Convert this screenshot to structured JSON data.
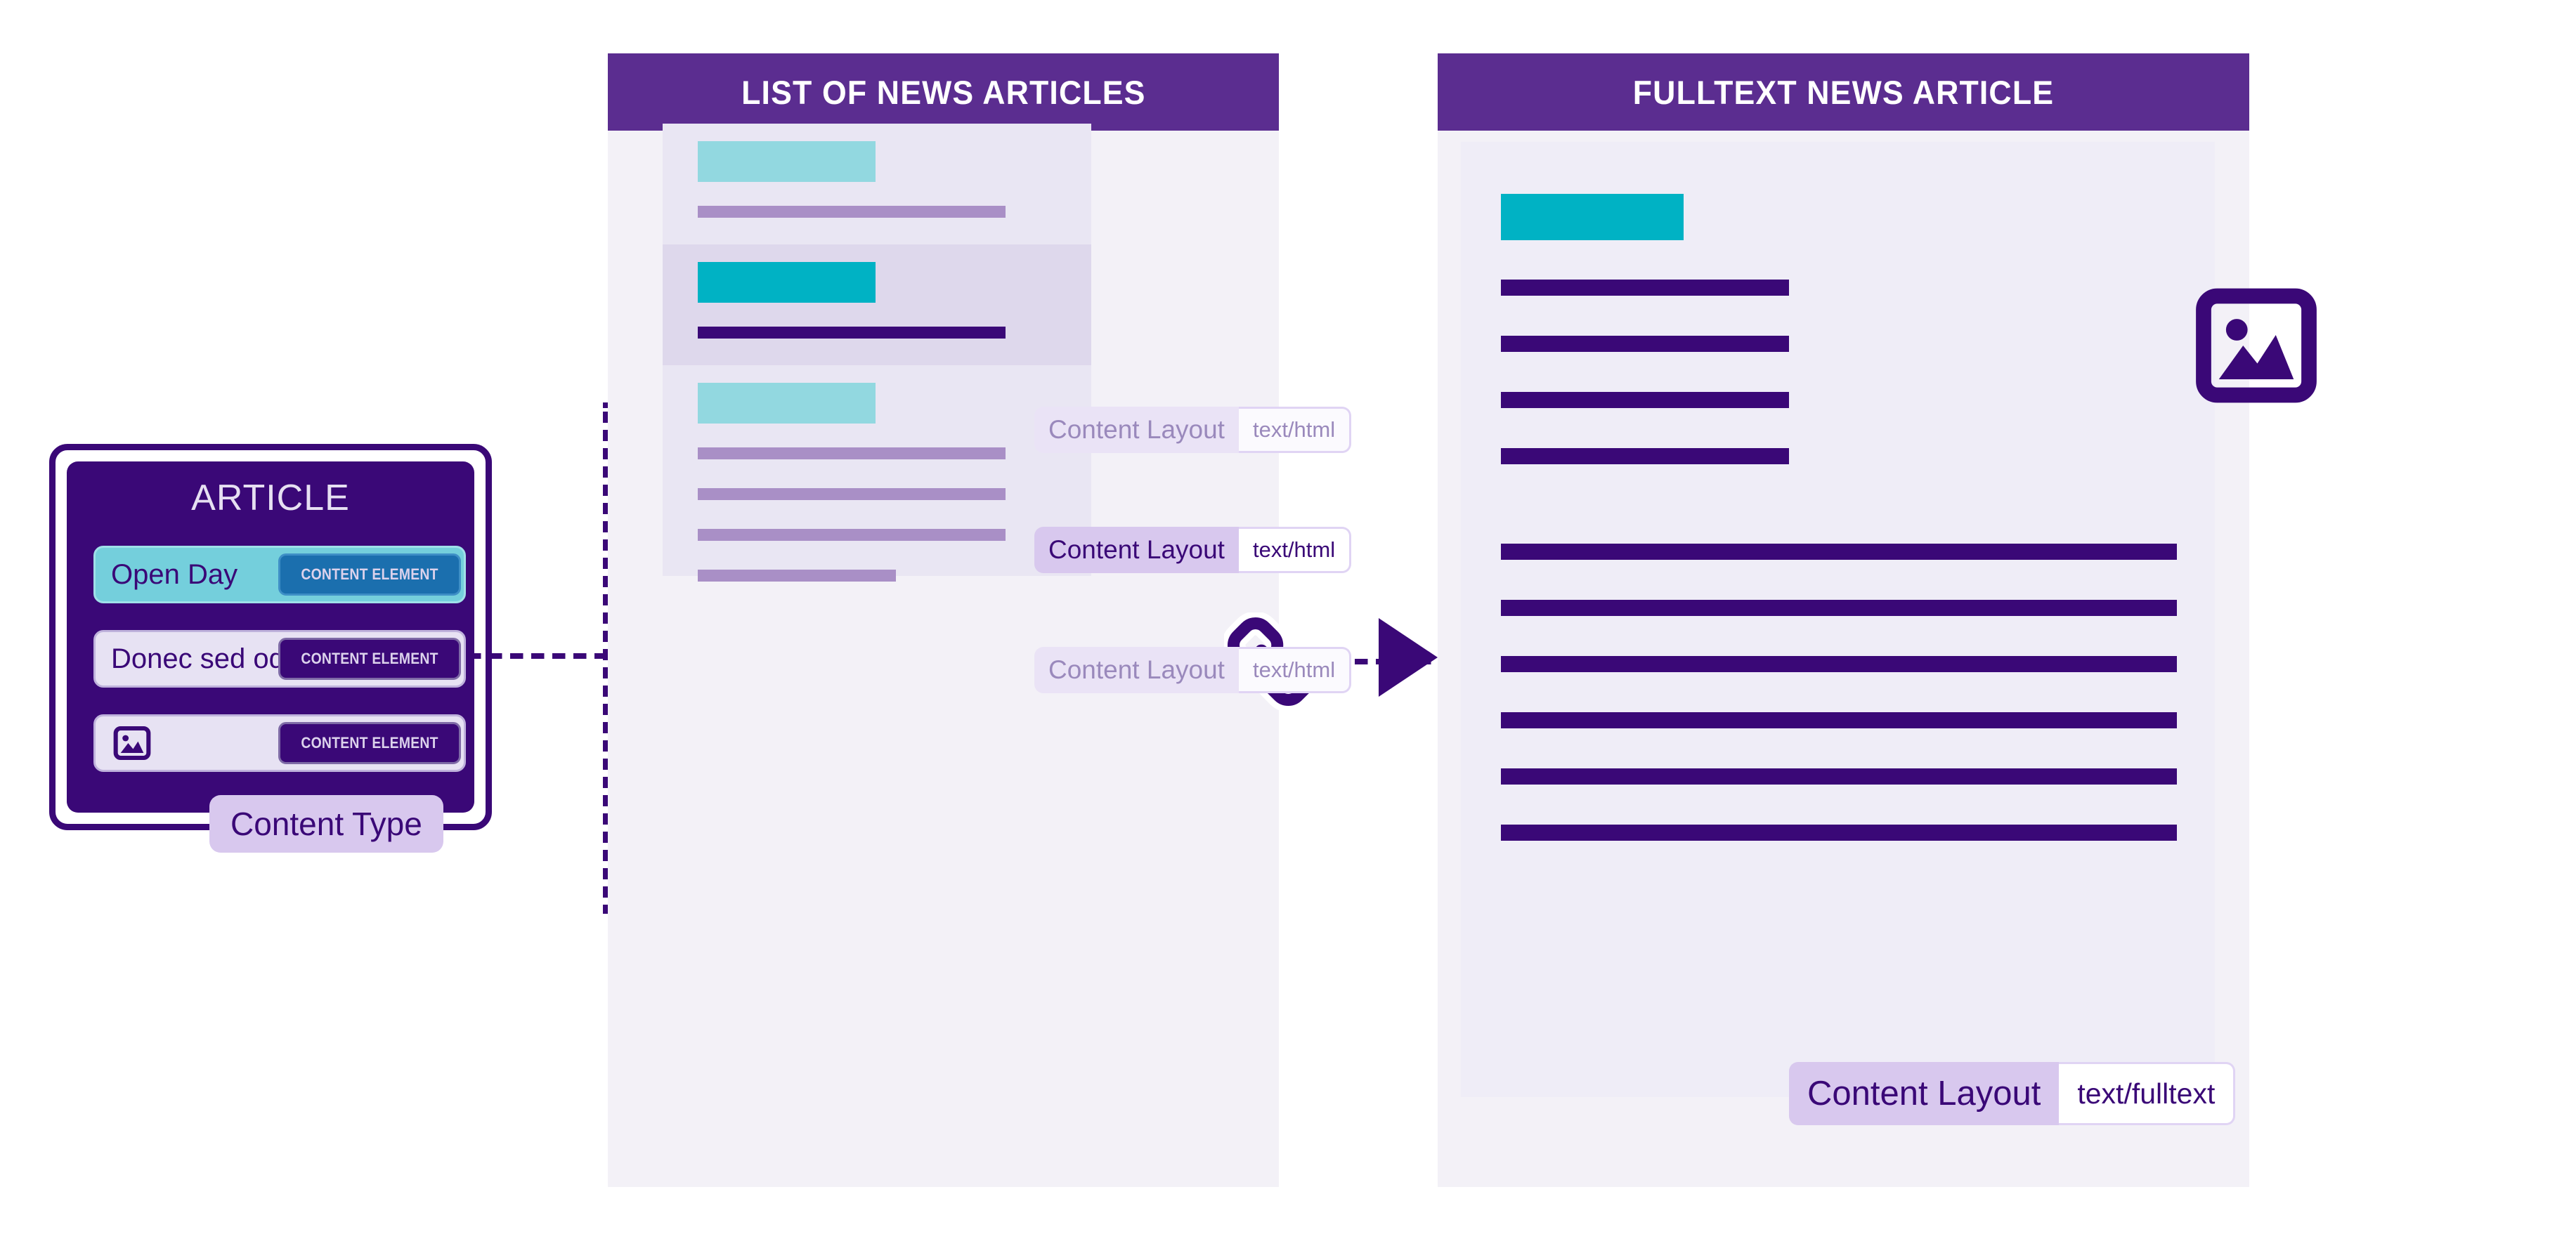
{
  "content_type_card": {
    "title": "ARTICLE",
    "rows": [
      {
        "label": "Open Day",
        "badge": "CONTENT ELEMENT",
        "style": "teal",
        "badge_style": "blue",
        "icon": null
      },
      {
        "label": "Donec sed od...",
        "badge": "CONTENT ELEMENT",
        "style": "lilac",
        "badge_style": "purple",
        "icon": null
      },
      {
        "label": "",
        "badge": "CONTENT ELEMENT",
        "style": "lilac",
        "badge_style": "purple",
        "icon": "image-icon"
      }
    ],
    "pill_label": "Content Type"
  },
  "list_panel": {
    "title": "LIST OF NEWS ARTICLES",
    "cards": [
      {
        "emphasis": "muted",
        "badge_left": "Content Layout",
        "badge_right": "text/html"
      },
      {
        "emphasis": "bold",
        "badge_left": "Content Layout",
        "badge_right": "text/html"
      },
      {
        "emphasis": "muted",
        "badge_left": "Content Layout",
        "badge_right": "text/html"
      }
    ]
  },
  "flow": {
    "link_icon": "link-chain-icon",
    "arrow_icon": "arrow-right-icon"
  },
  "fulltext_panel": {
    "title": "FULLTEXT NEWS ARTICLE",
    "image_icon": "image-icon",
    "badge_left": "Content Layout",
    "badge_right": "text/fulltext"
  },
  "colors": {
    "deep_purple": "#3A0877",
    "header_purple": "#5B2D90",
    "panel_bg": "#F3F1F7",
    "card_bg_muted": "#E9E6F3",
    "card_bg_strong": "#DED8EC",
    "teal_strong": "#00B2C4",
    "teal_muted": "#92D8E0",
    "line_muted": "#A98FC6",
    "pill_bg": "#D8C8EE",
    "badge_blue": "#1B6FAE"
  }
}
